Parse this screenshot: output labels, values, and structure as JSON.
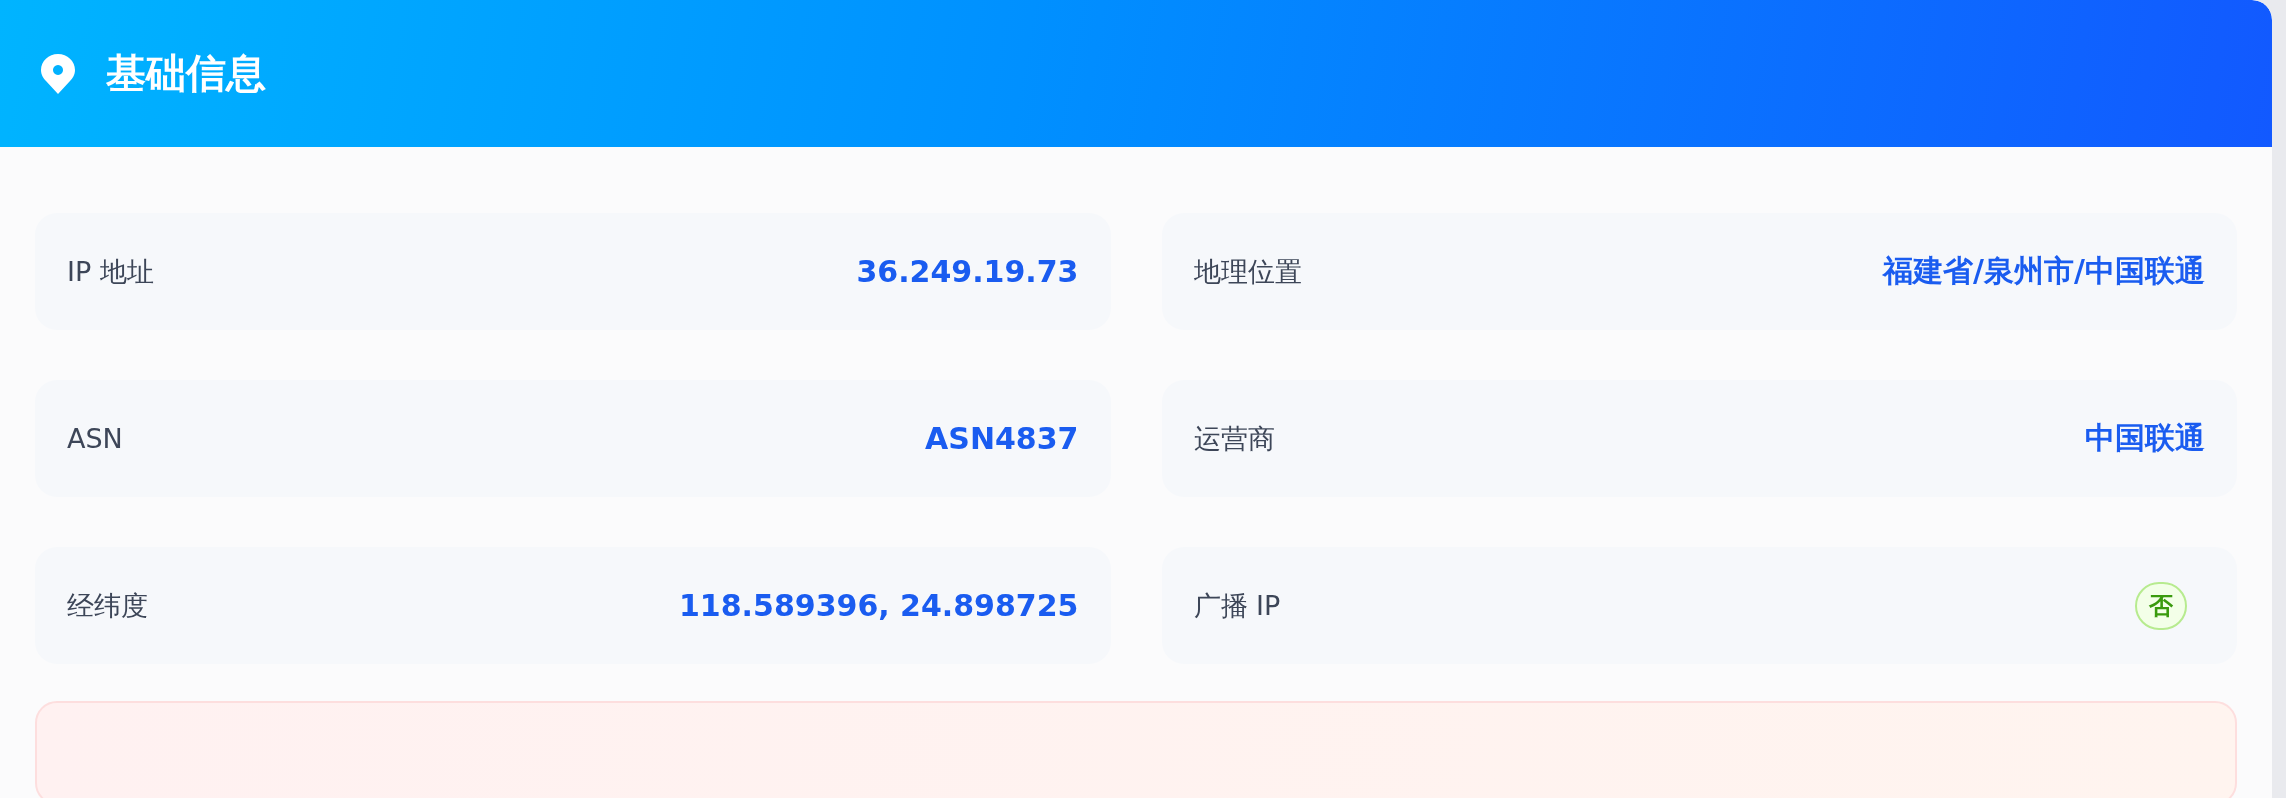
{
  "header": {
    "title": "基础信息"
  },
  "fields": [
    {
      "label": "IP 地址",
      "value": "36.249.19.73",
      "kind": "text"
    },
    {
      "label": "地理位置",
      "value": "福建省/泉州市/中国联通",
      "kind": "text"
    },
    {
      "label": "ASN",
      "value": "ASN4837",
      "kind": "text"
    },
    {
      "label": "运营商",
      "value": "中国联通",
      "kind": "text"
    },
    {
      "label": "经纬度",
      "value": "118.589396, 24.898725",
      "kind": "text"
    },
    {
      "label": "广播 IP",
      "value": "否",
      "kind": "badge"
    }
  ]
}
